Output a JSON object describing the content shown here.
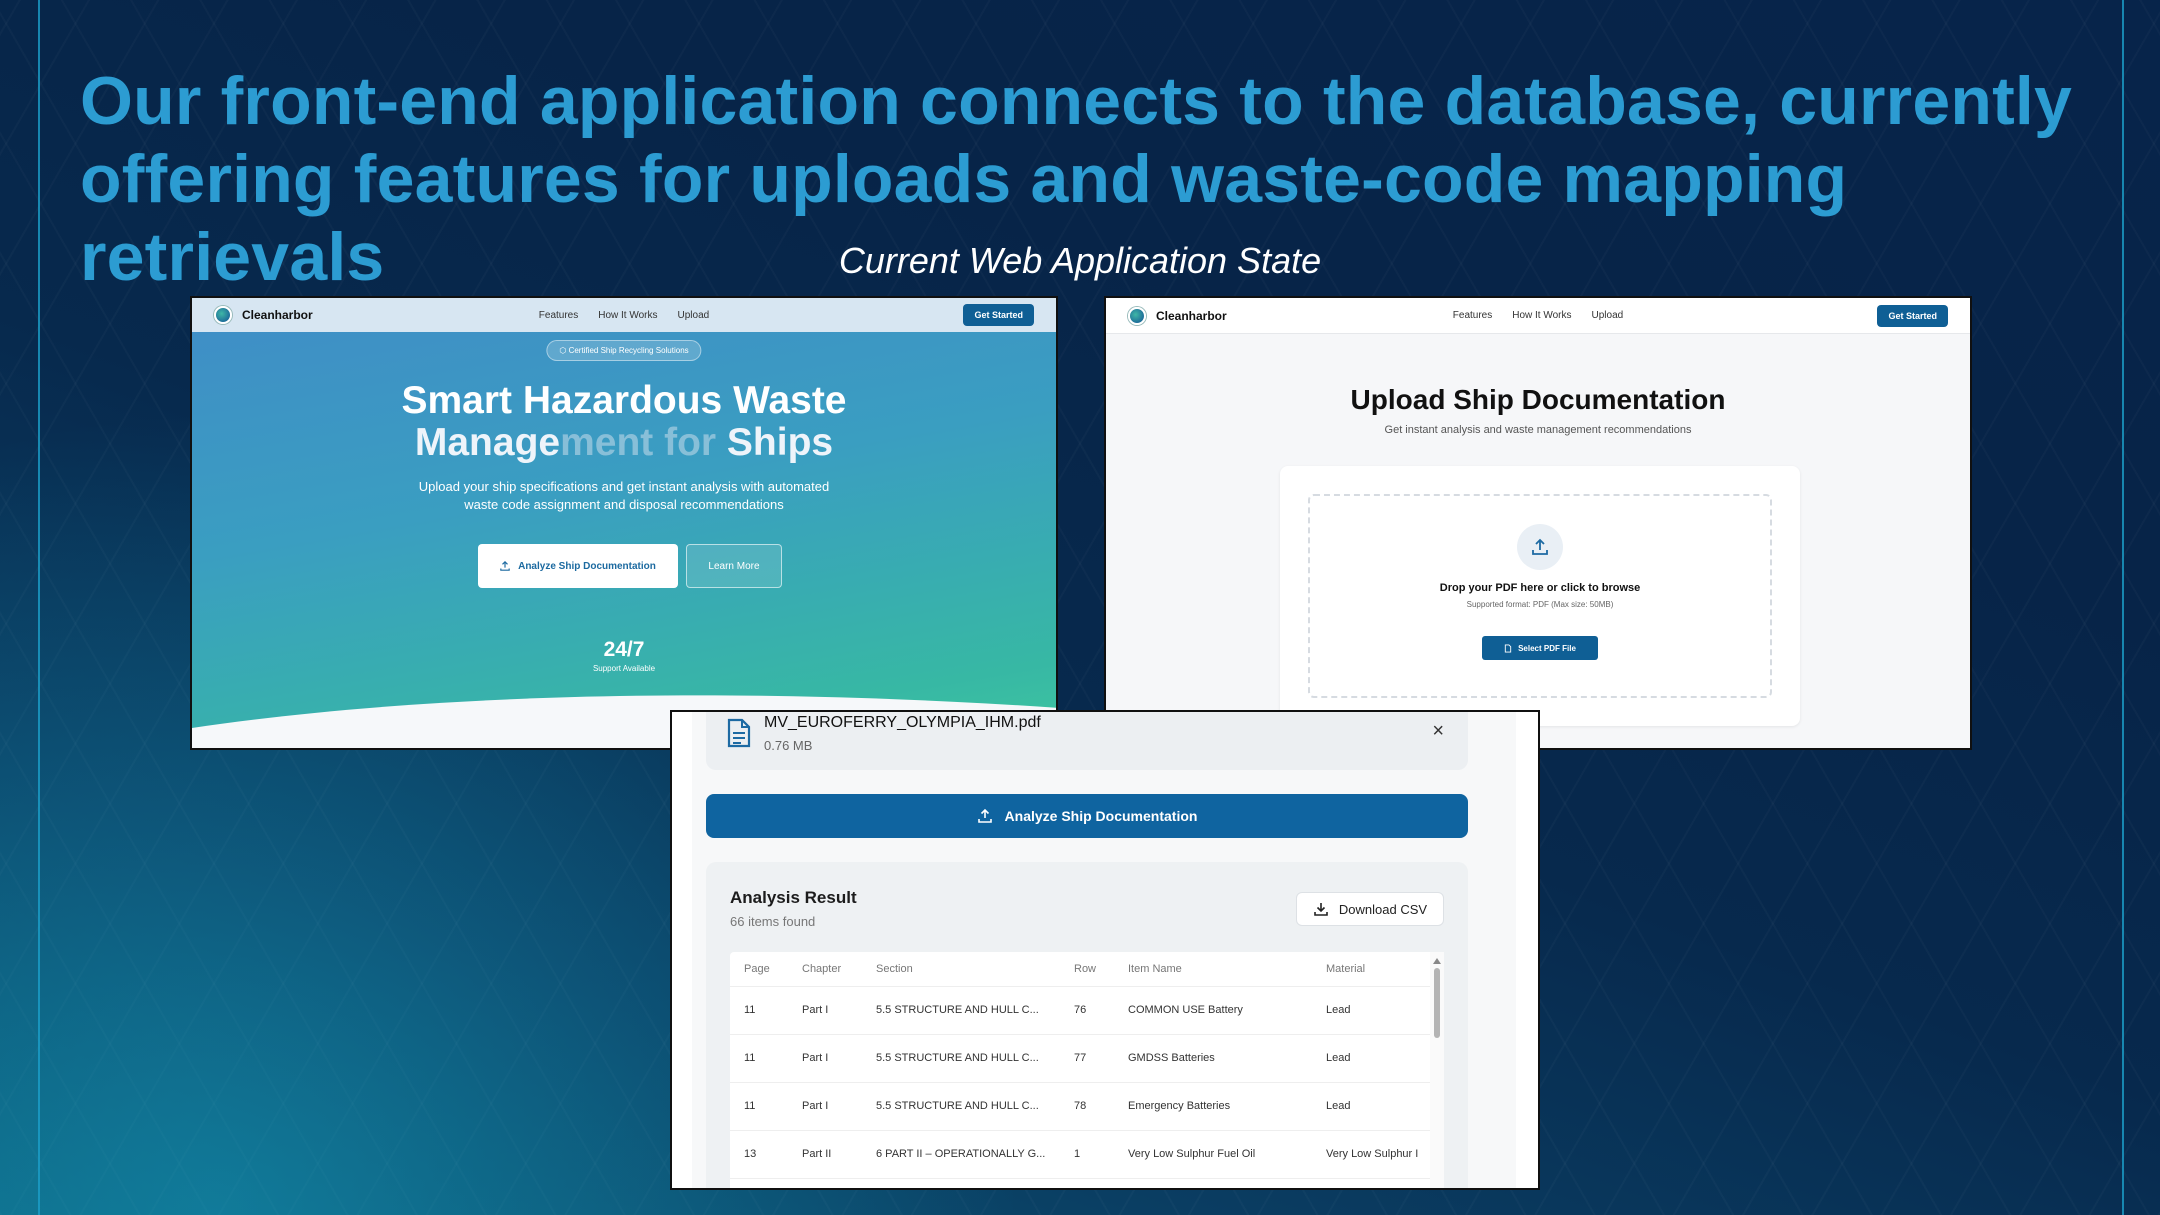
{
  "slide": {
    "title": "Our front-end application connects to the database, currently offering features for uploads and waste-code mapping retrievals",
    "subtitle": "Current Web Application State"
  },
  "nav": {
    "brand": "Cleanharbor",
    "links": [
      "Features",
      "How It Works",
      "Upload"
    ],
    "cta": "Get Started"
  },
  "landing": {
    "badge": "Certified Ship Recycling Solutions",
    "title_line1": "Smart Hazardous Waste",
    "title_line2_a": "Manage",
    "title_line2_b": "ment for",
    "title_line2_c": " Ships",
    "description": "Upload your ship specifications and get instant analysis with automated waste code assignment and disposal recommendations",
    "primary_button": "Analyze Ship Documentation",
    "secondary_button": "Learn More",
    "stat_value": "24/7",
    "stat_label": "Support Available"
  },
  "upload_page": {
    "title": "Upload Ship Documentation",
    "subtitle": "Get instant analysis and waste management recommendations",
    "drop_text": "Drop your PDF here or click to browse",
    "hint": "Supported format: PDF (Max size: 50MB)",
    "select_button": "Select PDF File"
  },
  "analysis": {
    "file_name": "MV_EUROFERRY_OLYMPIA_IHM.pdf",
    "file_size": "0.76 MB",
    "analyze_button": "Analyze Ship Documentation",
    "result_title": "Analysis Result",
    "result_count": "66 items found",
    "download_button": "Download CSV",
    "columns": [
      "Page",
      "Chapter",
      "Section",
      "Row",
      "Item Name",
      "Material"
    ],
    "rows": [
      [
        "11",
        "Part I",
        "5.5 STRUCTURE AND HULL C...",
        "76",
        "COMMON USE Battery",
        "Lead"
      ],
      [
        "11",
        "Part I",
        "5.5 STRUCTURE AND HULL C...",
        "77",
        "GMDSS Batteries",
        "Lead"
      ],
      [
        "11",
        "Part I",
        "5.5 STRUCTURE AND HULL C...",
        "78",
        "Emergency Batteries",
        "Lead"
      ],
      [
        "13",
        "Part II",
        "6 PART II – OPERATIONALLY G...",
        "1",
        "Very Low Sulphur Fuel Oil",
        "Very Low Sulphur I"
      ]
    ]
  },
  "colors": {
    "title": "#2c9cd2",
    "brand_blue": "#0f5f95",
    "hero_start": "#3f8fc6",
    "hero_end": "#3fc7a0"
  }
}
